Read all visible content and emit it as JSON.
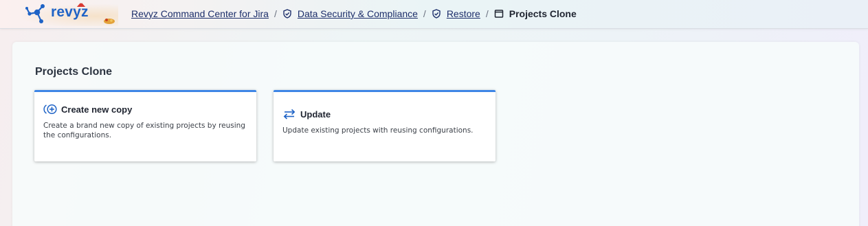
{
  "header": {
    "logo_text": "revyz",
    "breadcrumb": [
      {
        "label": "Revyz Command Center for Jira",
        "icon": null,
        "link": true
      },
      {
        "label": "Data Security & Compliance",
        "icon": "shield-check-icon",
        "link": true
      },
      {
        "label": "Restore",
        "icon": "shield-check-icon",
        "link": true
      },
      {
        "label": "Projects Clone",
        "icon": "window-icon",
        "link": false
      }
    ],
    "separator": "/"
  },
  "main": {
    "title": "Projects Clone",
    "cards": [
      {
        "title": "Create new copy",
        "description": "Create a brand new copy of existing projects by reusing the configurations.",
        "icon": "add-circle-icon"
      },
      {
        "title": "Update",
        "description": "Update existing projects with reusing configurations.",
        "icon": "swap-arrows-icon"
      }
    ]
  },
  "colors": {
    "accent": "#3e86e6",
    "brand": "#1f63c6",
    "link": "#1c2e6a"
  }
}
